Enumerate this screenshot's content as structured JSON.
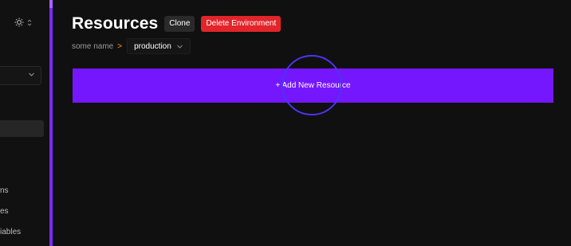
{
  "sidebar": {
    "theme_icon": "sun-icon",
    "toggle_icon": "chevron-updown-icon",
    "select_icon": "chevron-down-icon",
    "links": [
      {
        "label": "ns"
      },
      {
        "label": "es"
      },
      {
        "label": "iables"
      }
    ]
  },
  "header": {
    "title": "Resources",
    "clone_label": "Clone",
    "delete_label": "Delete Environment"
  },
  "breadcrumb": {
    "project": "some name",
    "separator": ">",
    "environment": "production"
  },
  "main": {
    "add_resource_label": "+ Add New Resource"
  },
  "colors": {
    "accent": "#7417ff",
    "danger": "#e1252a",
    "background": "#101010",
    "separator": "#ff9a2e"
  }
}
